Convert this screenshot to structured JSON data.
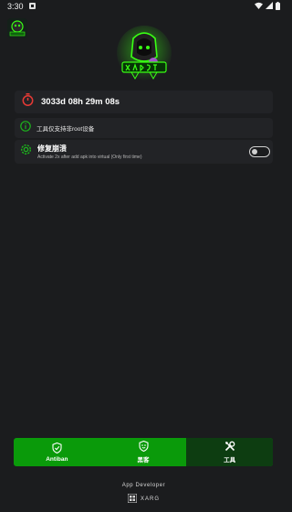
{
  "status_bar": {
    "time": "3:30"
  },
  "timer": {
    "value": "3033d 08h 29m 08s"
  },
  "info": {
    "text": "工具仅支持非root设备"
  },
  "fix_crash": {
    "title": "修复崩溃",
    "subtitle": "Activate 2x after add apk into virtual (Only first time)",
    "enabled": false
  },
  "nav": {
    "items": [
      {
        "label": "Antiban",
        "icon": "shield-check-icon",
        "active": false
      },
      {
        "label": "黑客",
        "icon": "shield-face-icon",
        "active": false
      },
      {
        "label": "工具",
        "icon": "tools-icon",
        "active": true
      }
    ]
  },
  "footer": {
    "title": "App Developer",
    "brand": "XARG"
  },
  "colors": {
    "accent": "#0a9a0a",
    "accent_dark": "#0d3d11",
    "timer_icon": "#e53935",
    "background": "#1b1c1e",
    "card": "#222326"
  }
}
